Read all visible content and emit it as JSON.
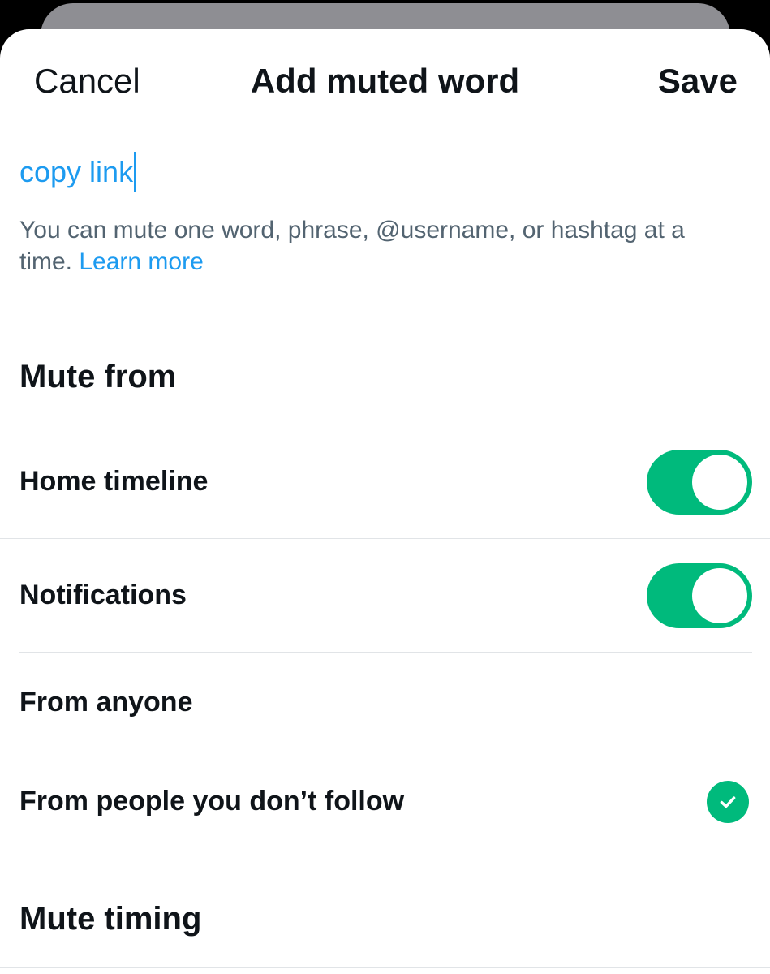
{
  "header": {
    "cancel_label": "Cancel",
    "title": "Add muted word",
    "save_label": "Save"
  },
  "word_input": {
    "value": "copy link"
  },
  "hint": {
    "text": "You can mute one word, phrase, @username, or hashtag at a time.",
    "link_label": "Learn more"
  },
  "mute_from": {
    "title": "Mute from",
    "options": [
      {
        "label": "Home timeline",
        "enabled": true
      },
      {
        "label": "Notifications",
        "enabled": true
      }
    ]
  },
  "audience": {
    "options": [
      {
        "label": "From anyone",
        "selected": false
      },
      {
        "label": "From people you don’t follow",
        "selected": true
      }
    ]
  },
  "mute_timing": {
    "title": "Mute timing"
  },
  "colors": {
    "accent": "#1d9bf0",
    "toggle_on": "#00ba7c",
    "text_primary": "#0f1419",
    "text_secondary": "#536471"
  }
}
